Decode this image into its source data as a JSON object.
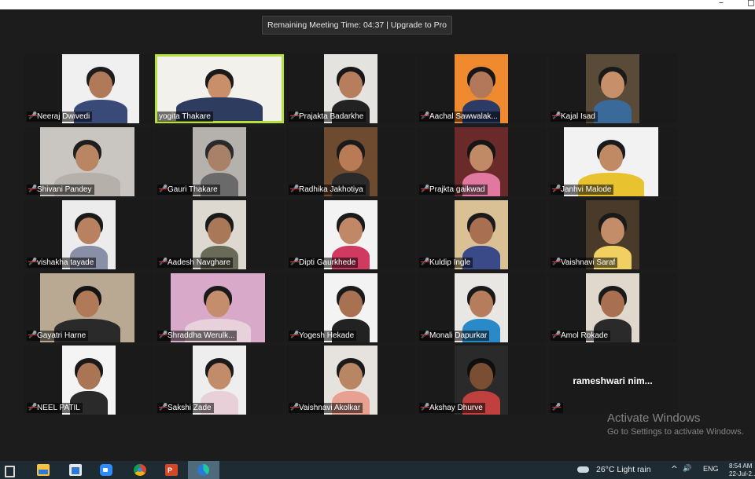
{
  "window": {
    "minimize_glyph": "–",
    "restore_glyph": "◻"
  },
  "meeting": {
    "timer_text": "Remaining Meeting Time: 04:37 | Upgrade to Pro",
    "participants": [
      {
        "name": "Neeraj Dwivedi",
        "muted": true,
        "video": true,
        "active": false
      },
      {
        "name": "yogita Thakare",
        "muted": false,
        "video": true,
        "active": true
      },
      {
        "name": "Prajakta Badarkhe",
        "muted": true,
        "video": true,
        "active": false
      },
      {
        "name": "Aachal Sawwalak...",
        "muted": true,
        "video": true,
        "active": false
      },
      {
        "name": "Kajal Isad",
        "muted": true,
        "video": true,
        "active": false
      },
      {
        "name": "Shivani Pandey",
        "muted": true,
        "video": true,
        "active": false
      },
      {
        "name": "Gauri Thakare",
        "muted": true,
        "video": true,
        "active": false
      },
      {
        "name": "Radhika Jakhotiya",
        "muted": true,
        "video": true,
        "active": false
      },
      {
        "name": "Prajkta gaikwad",
        "muted": true,
        "video": true,
        "active": false
      },
      {
        "name": "Janhvi Malode",
        "muted": true,
        "video": true,
        "active": false
      },
      {
        "name": "vishakha tayade",
        "muted": true,
        "video": true,
        "active": false
      },
      {
        "name": "Aadesh Navghare",
        "muted": true,
        "video": true,
        "active": false
      },
      {
        "name": "Dipti Gaurkhede",
        "muted": true,
        "video": true,
        "active": false
      },
      {
        "name": "Kuldip Ingle",
        "muted": true,
        "video": true,
        "active": false
      },
      {
        "name": "Vaishnavi Saraf",
        "muted": true,
        "video": true,
        "active": false
      },
      {
        "name": "Gayatri Harne",
        "muted": true,
        "video": true,
        "active": false
      },
      {
        "name": "Shraddha Werulk...",
        "muted": true,
        "video": true,
        "active": false
      },
      {
        "name": "Yogesh Hekade",
        "muted": true,
        "video": true,
        "active": false
      },
      {
        "name": "Monali Dapurkar",
        "muted": true,
        "video": true,
        "active": false
      },
      {
        "name": "Amol Rokade",
        "muted": true,
        "video": true,
        "active": false
      },
      {
        "name": "NEEL PATIL",
        "muted": true,
        "video": true,
        "active": false
      },
      {
        "name": "Sakshi Zade",
        "muted": true,
        "video": true,
        "active": false
      },
      {
        "name": "Vaishnavi Akolkar",
        "muted": true,
        "video": true,
        "active": false
      },
      {
        "name": "Akshay Dhurve",
        "muted": true,
        "video": true,
        "active": false
      },
      {
        "name": "rameshwari  nim...",
        "muted": true,
        "video": false,
        "active": false
      }
    ]
  },
  "watermark": {
    "title": "Activate Windows",
    "subtitle": "Go to Settings to activate Windows."
  },
  "taskbar": {
    "weather_text": "26°C  Light rain",
    "tray_chevron": "^",
    "volume_glyph": "🔊",
    "language": "ENG",
    "time": "8:54 AM",
    "date": "22-Jul-2..."
  }
}
